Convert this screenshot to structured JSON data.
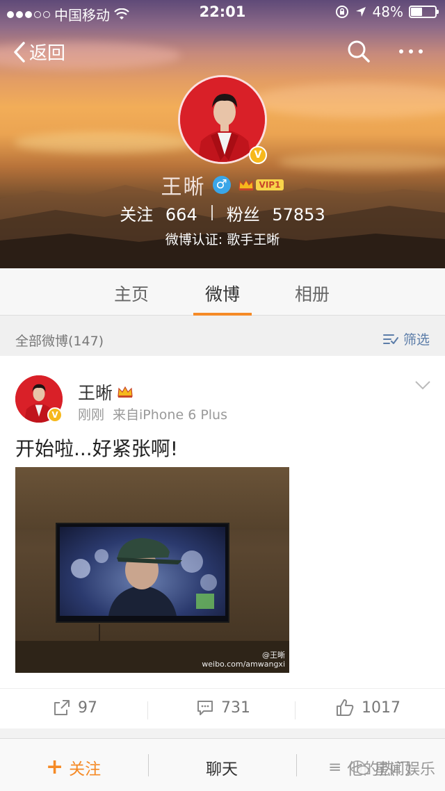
{
  "status_bar": {
    "carrier": "中国移动",
    "time": "22:01",
    "battery_percent": "48%",
    "battery_level": 0.48,
    "signal_dots_filled": 3,
    "signal_dots_total": 5
  },
  "nav": {
    "back_label": "返回",
    "icons": [
      "search-icon",
      "more-icon"
    ]
  },
  "profile": {
    "name": "王晰",
    "vip_label": "VIP1",
    "following_label": "关注",
    "following_count": "664",
    "followers_label": "粉丝",
    "followers_count": "57853",
    "verification": "微博认证: 歌手王晰"
  },
  "tabs": {
    "home": "主页",
    "weibo": "微博",
    "album": "相册",
    "active": "weibo"
  },
  "filter": {
    "title": "全部微博(147)",
    "button_label": "筛选"
  },
  "post": {
    "author": "王晰",
    "time": "刚刚",
    "source": "来自iPhone 6 Plus",
    "text": "开始啦...好紧张啊!",
    "image_watermark_name": "@王晰",
    "image_watermark_url": "weibo.com/amwangxi",
    "reposts": "97",
    "comments": "731",
    "likes": "1017"
  },
  "bottom_bar": {
    "follow": "关注",
    "chat": "聊天",
    "hot": "他的热门",
    "overlay_logo": "星闻娱乐"
  },
  "colors": {
    "accent": "#f58a26",
    "link": "#5b7ca8",
    "vip_gold": "#f6b81c"
  }
}
